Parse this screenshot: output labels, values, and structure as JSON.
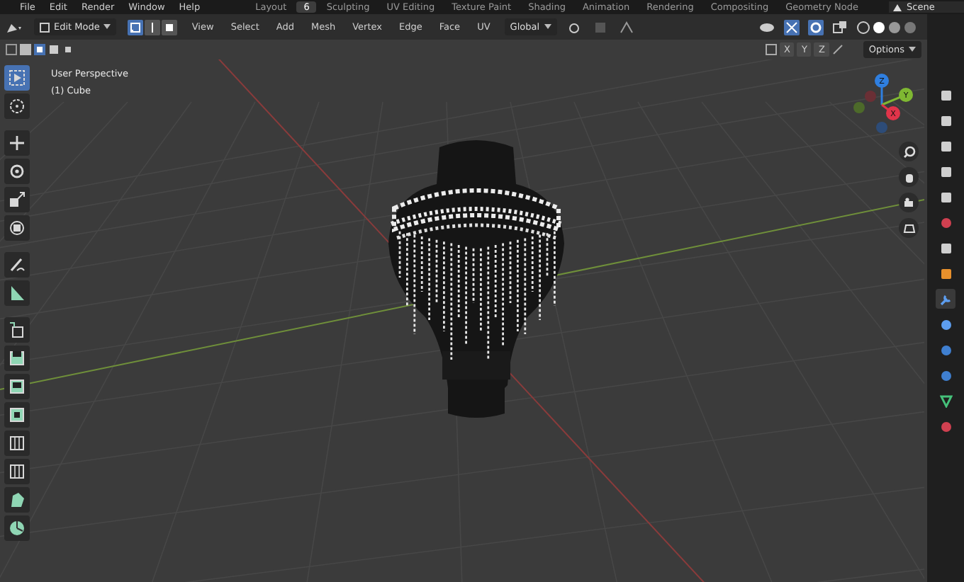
{
  "top_bar": {
    "menus": [
      "File",
      "Edit",
      "Render",
      "Window",
      "Help"
    ],
    "workspaces": [
      {
        "label": "Layout",
        "selected": false
      },
      {
        "label": "6",
        "selected": true
      },
      {
        "label": "Sculpting",
        "selected": false
      },
      {
        "label": "UV Editing",
        "selected": false
      },
      {
        "label": "Texture Paint",
        "selected": false
      },
      {
        "label": "Shading",
        "selected": false
      },
      {
        "label": "Animation",
        "selected": false
      },
      {
        "label": "Rendering",
        "selected": false
      },
      {
        "label": "Compositing",
        "selected": false
      },
      {
        "label": "Geometry Node",
        "selected": false
      }
    ],
    "scene": "Scene"
  },
  "header": {
    "mode": "Edit Mode",
    "select_modes": [
      {
        "kind": "vertex",
        "selected": true
      },
      {
        "kind": "edge",
        "selected": false
      },
      {
        "kind": "face",
        "selected": false
      }
    ],
    "menus": [
      "View",
      "Select",
      "Add",
      "Mesh",
      "Vertex",
      "Edge",
      "Face",
      "UV"
    ],
    "orientation": "Global"
  },
  "tool_settings": {
    "axes": [
      "X",
      "Y",
      "Z"
    ],
    "options": "Options"
  },
  "viewport": {
    "title": "User Perspective",
    "object": "(1) Cube",
    "gizmo": [
      {
        "label": "Z",
        "color": "#2f7fe0"
      },
      {
        "label": "Y",
        "color": "#7fb832"
      },
      {
        "label": "X",
        "color": "#e0344a"
      }
    ]
  },
  "toolbar": [
    {
      "kind": "select",
      "selected": true
    },
    {
      "kind": "cursor",
      "selected": false
    },
    {
      "kind": "move",
      "selected": false
    },
    {
      "kind": "rotate",
      "selected": false
    },
    {
      "kind": "scale",
      "selected": false
    },
    {
      "kind": "transform",
      "selected": false
    },
    {
      "kind": "annotate",
      "selected": false
    },
    {
      "kind": "measure",
      "selected": false
    },
    {
      "kind": "add-cube",
      "selected": false
    },
    {
      "kind": "extrude",
      "selected": false
    },
    {
      "kind": "inset",
      "selected": false
    },
    {
      "kind": "bevel",
      "selected": false
    },
    {
      "kind": "loop-cut",
      "selected": false
    },
    {
      "kind": "knife",
      "selected": false
    },
    {
      "kind": "poly-build",
      "selected": false
    },
    {
      "kind": "spin",
      "selected": false
    }
  ],
  "properties_tabs": [
    {
      "kind": "tool",
      "selected": false
    },
    {
      "kind": "render",
      "selected": false
    },
    {
      "kind": "output",
      "selected": false
    },
    {
      "kind": "view-layer",
      "selected": false
    },
    {
      "kind": "scene",
      "selected": false
    },
    {
      "kind": "world",
      "selected": false
    },
    {
      "kind": "collection",
      "selected": false
    },
    {
      "kind": "object",
      "selected": false
    },
    {
      "kind": "modifier",
      "selected": true
    },
    {
      "kind": "particles",
      "selected": false
    },
    {
      "kind": "physics",
      "selected": false
    },
    {
      "kind": "constraints",
      "selected": false
    },
    {
      "kind": "data",
      "selected": false
    },
    {
      "kind": "material",
      "selected": false
    }
  ]
}
